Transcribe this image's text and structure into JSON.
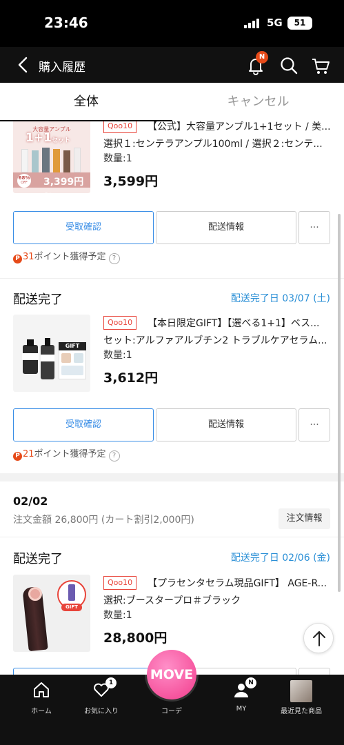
{
  "status_bar": {
    "time": "23:46",
    "network": "5G",
    "battery": "51"
  },
  "header": {
    "title": "購入履歴",
    "notification_badge": "N"
  },
  "tabs": [
    {
      "label": "全体",
      "selected": true
    },
    {
      "label": "キャンセル",
      "selected": false
    }
  ],
  "orders": [
    {
      "items": [
        {
          "shop_tag": "Qoo10",
          "title": "【公式】大容量アンプル1+1セット / 美...",
          "option": "選択１:センテラアンプル100ml / 選択２:センテ...",
          "quantity": "数量:1",
          "price": "3,599円",
          "thumb": {
            "heading": "大容量アンプル",
            "big": "1+1",
            "sub": "セット",
            "badge": "68%",
            "badge_sub": "OFF",
            "price": "3,399円~"
          },
          "buttons": {
            "receive": "受取確認",
            "shipping": "配送情報",
            "more": "···"
          },
          "points": {
            "num": "31",
            "text": "ポイント獲得予定",
            "icon": "P",
            "help": "?"
          }
        },
        {
          "status": "配送完了",
          "status_date": "配送完了日 03/07 (土)",
          "shop_tag": "Qoo10",
          "title": "【本日限定GIFT】【選べる1+1】ベス...",
          "option": "セット:アルファアルブチン2 トラブルケアセラム...",
          "quantity": "数量:1",
          "price": "3,612円",
          "thumb": {
            "gift_label": "GIFT"
          },
          "buttons": {
            "receive": "受取確認",
            "shipping": "配送情報",
            "more": "···"
          },
          "points": {
            "num": "21",
            "text": "ポイント獲得予定",
            "icon": "P",
            "help": "?"
          }
        }
      ]
    },
    {
      "order_date": "02/02",
      "order_total": "注文金額 26,800円 (カート割引2,000円)",
      "order_info_button": "注文情報",
      "items": [
        {
          "status": "配送完了",
          "status_date": "配送完了日 02/06 (金)",
          "shop_tag": "Qoo10",
          "title": "【プラセンタセラム現品GIFT】 AGE-R...",
          "option": "選択:ブースタープロ＃ブラック",
          "quantity": "数量:1",
          "price": "28,800円",
          "thumb": {
            "gift_label": "GIFT"
          }
        }
      ]
    }
  ],
  "bottom_nav": [
    {
      "label": "ホーム",
      "icon": "home-icon"
    },
    {
      "label": "お気に入り",
      "icon": "heart-icon",
      "badge": "1"
    },
    {
      "label": "コーデ",
      "icon": "move-icon",
      "center_text": "MOVE"
    },
    {
      "label": "MY",
      "icon": "user-icon",
      "badge": "N"
    },
    {
      "label": "最近見た商品",
      "icon": "recent-icon"
    }
  ],
  "colors": {
    "accent_blue": "#3a8ee6",
    "qoo_red": "#e8443a",
    "move_pink": "#f23c8c"
  }
}
